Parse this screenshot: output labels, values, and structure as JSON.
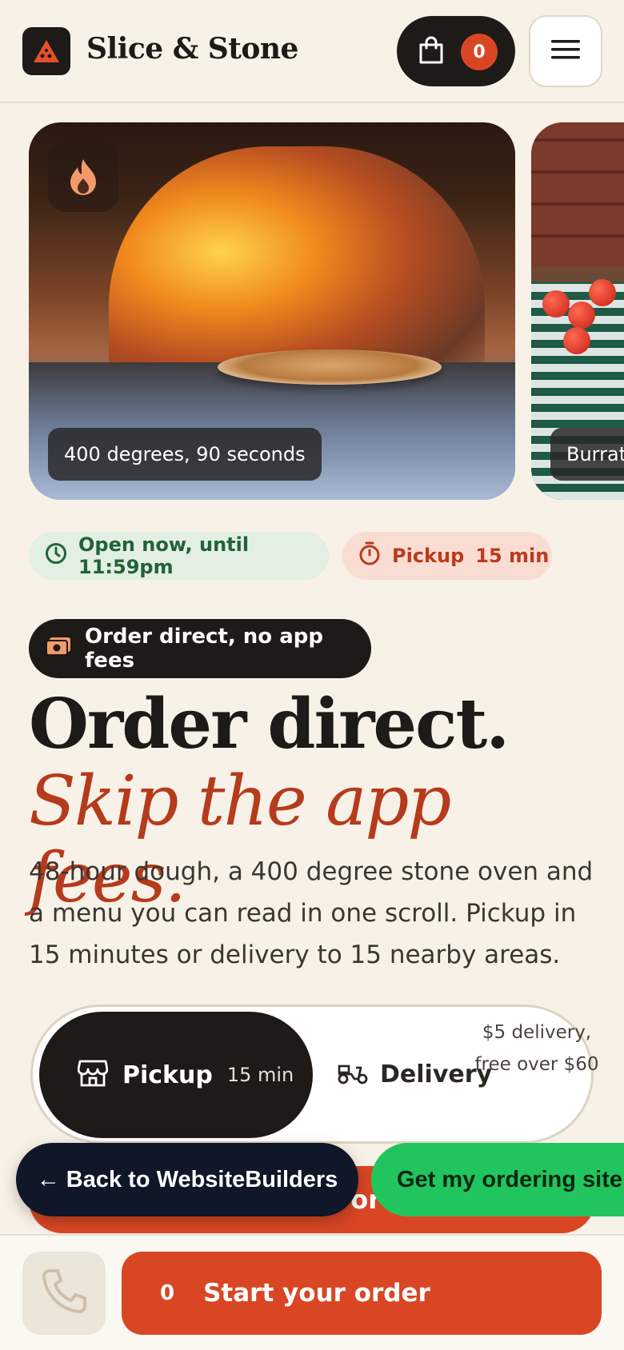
{
  "header": {
    "brand": "Slice & Stone",
    "cart_count": "0"
  },
  "carousel": {
    "slides": [
      {
        "caption": "400 degrees, 90 seconds"
      },
      {
        "caption": "Burrat"
      }
    ]
  },
  "status": {
    "open": "Open now, until 11:59pm",
    "pickup_label": "Pickup",
    "pickup_time": "15 min"
  },
  "tag": "Order direct, no app fees",
  "hero": {
    "headline_plain": "Order direct.",
    "headline_accent": "Skip the app fees.",
    "lead": "48-hour dough, a 400 degree stone oven and a menu you can read in one scroll. Pickup in 15 minutes or delivery to 15 nearby areas."
  },
  "mode": {
    "pickup_label": "Pickup",
    "pickup_time": "15 min",
    "delivery_label": "Delivery",
    "delivery_fee": "$5 delivery, free over $60"
  },
  "order_under_label": "Start your order",
  "floating": {
    "back": "← Back to WebsiteBuilders",
    "get": "Get my ordering site"
  },
  "bottom_bar": {
    "count": "0",
    "start_label": "Start your order"
  },
  "colors": {
    "accent": "#d94624",
    "dark": "#1d1a17",
    "background": "#f7f1e7",
    "green": "#21c55d"
  }
}
